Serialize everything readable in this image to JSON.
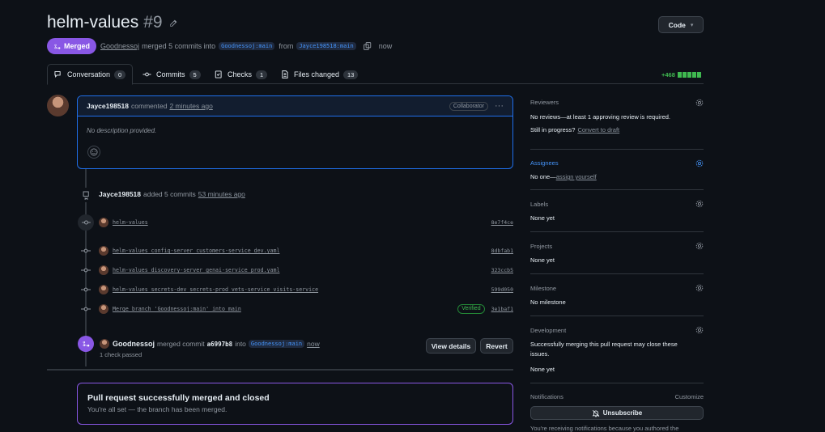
{
  "header": {
    "title": "helm-values",
    "number": "#9",
    "code_button": "Code",
    "state_label": "Merged",
    "author": "Goodnessoj",
    "merge_text": "merged 5 commits into",
    "base_branch": "Goodnessoj:main",
    "from_text": "from",
    "head_branch": "Jayce198518:main",
    "time": "now"
  },
  "tabs": [
    {
      "label": "Conversation",
      "count": "0"
    },
    {
      "label": "Commits",
      "count": "5"
    },
    {
      "label": "Checks",
      "count": "1"
    },
    {
      "label": "Files changed",
      "count": "13"
    }
  ],
  "diffstat": "+468",
  "comment": {
    "author": "Jayce198518",
    "action": "commented",
    "time": "2 minutes ago",
    "role": "Collaborator",
    "body": "No description provided."
  },
  "commits_event": {
    "author": "Jayce198518",
    "action": "added 5 commits",
    "time": "53 minutes ago",
    "commits": [
      {
        "message": "helm-values",
        "sha": "8e7f4ce",
        "verified": ""
      },
      {
        "message": "helm-values config-server customers-service dev.yaml",
        "sha": "8dbfab1",
        "verified": ""
      },
      {
        "message": "helm-values discovery-server genai-service prod.yaml",
        "sha": "323ccb5",
        "verified": ""
      },
      {
        "message": "helm-values secrets-dev secrets-prod vets-service visits-service",
        "sha": "599d050",
        "verified": ""
      },
      {
        "message": "Merge branch 'Goodnessoj:main' into main",
        "sha": "3e1baf1",
        "verified": "Verified"
      }
    ]
  },
  "merge_event": {
    "author": "Goodnessoj",
    "action": "merged commit",
    "sha": "a6997b8",
    "into": "into",
    "branch": "Goodnessoj:main",
    "time": "now",
    "checks": "1 check passed",
    "view_details": "View details",
    "revert": "Revert"
  },
  "merged_box": {
    "title": "Pull request successfully merged and closed",
    "subtitle": "You're all set — the branch has been merged."
  },
  "sidebar": {
    "reviewers": {
      "heading": "Reviewers",
      "value": "No reviews—at least 1 approving review is required.",
      "progress": "Still in progress?",
      "link": "Convert to draft"
    },
    "assignees": {
      "heading": "Assignees",
      "value": "No one—",
      "link": "assign yourself"
    },
    "labels": {
      "heading": "Labels",
      "value": "None yet"
    },
    "projects": {
      "heading": "Projects",
      "value": "None yet"
    },
    "milestone": {
      "heading": "Milestone",
      "value": "No milestone"
    },
    "development": {
      "heading": "Development",
      "value": "Successfully merging this pull request may close these issues.",
      "value2": "None yet"
    },
    "notifications": {
      "heading": "Notifications",
      "customize": "Customize",
      "button": "Unsubscribe",
      "note": "You're receiving notifications because you authored the"
    }
  },
  "colors": {
    "merged": "#8957e5",
    "accent": "#4493f8",
    "success": "#3fb950"
  }
}
